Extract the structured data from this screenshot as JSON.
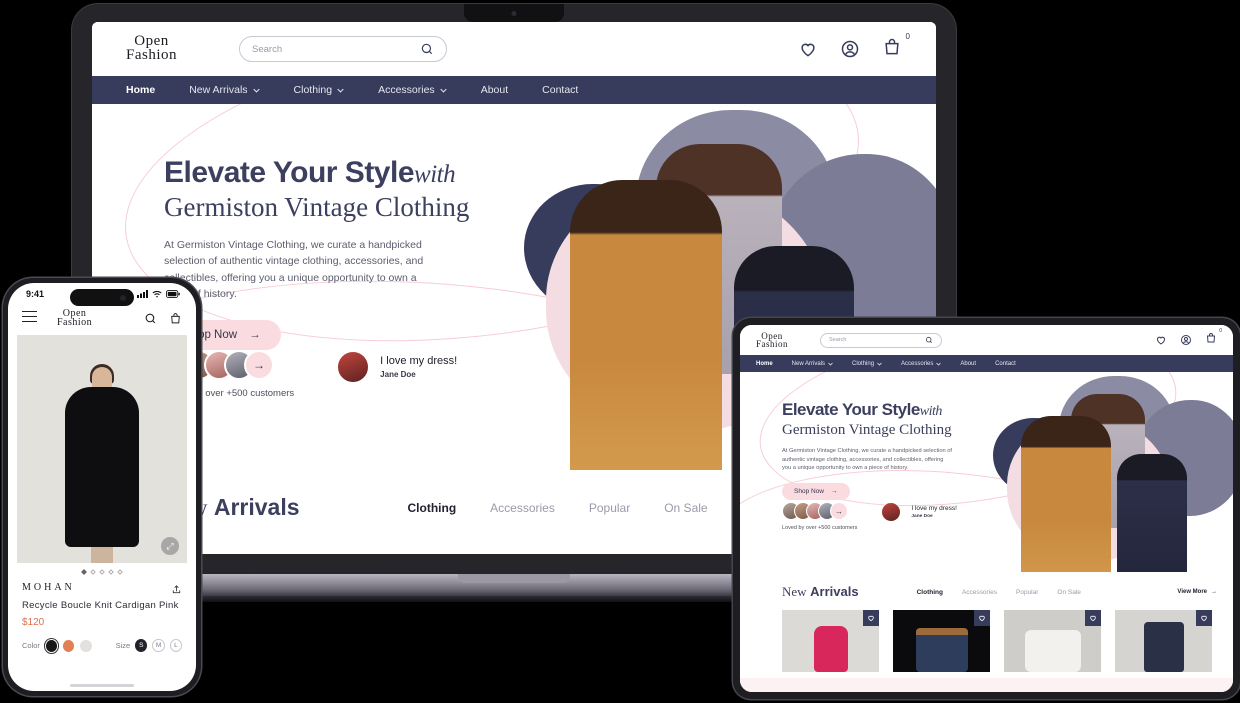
{
  "brand": {
    "line1": "Open",
    "line2": "Fashion"
  },
  "search": {
    "placeholder": "Search",
    "value": ""
  },
  "top_actions": {
    "wishlist_icon": "heart-icon",
    "account_icon": "user-circle-icon",
    "cart_icon": "shopping-bag-icon",
    "cart_count": "0"
  },
  "nav": {
    "items": [
      {
        "label": "Home",
        "has_dropdown": false,
        "active": true
      },
      {
        "label": "New Arrivals",
        "has_dropdown": true,
        "active": false
      },
      {
        "label": "Clothing",
        "has_dropdown": true,
        "active": false
      },
      {
        "label": "Accessories",
        "has_dropdown": true,
        "active": false
      },
      {
        "label": "About",
        "has_dropdown": false,
        "active": false
      },
      {
        "label": "Contact",
        "has_dropdown": false,
        "active": false
      }
    ]
  },
  "hero": {
    "headline_main": "Elevate Your Style",
    "headline_italic": "with",
    "headline_sub": "Germiston Vintage Clothing",
    "body": "At Germiston Vintage Clothing, we curate a handpicked selection of authentic vintage clothing, accessories, and collectibles, offering you a unique opportunity to own a piece of history.",
    "cta_label": "Shop Now",
    "cta_arrow": "arrow-right-icon",
    "social_proof": "Loved by over +500 customers",
    "avatar_arrow_icon": "arrow-right-icon",
    "testimonial_quote": "I love my dress!",
    "testimonial_author": "Jane Doe",
    "colors": {
      "navy": "#373b5c",
      "pink": "#fadce0",
      "gray_blob": "#8b8ba3",
      "pink_blob": "#f3dde2"
    }
  },
  "arrivals": {
    "title_part1": "New",
    "title_part2": "Arrivals",
    "tabs": [
      {
        "label": "Clothing",
        "active": true
      },
      {
        "label": "Accessories",
        "active": false
      },
      {
        "label": "Popular",
        "active": false
      },
      {
        "label": "On Sale",
        "active": false
      }
    ],
    "view_more_label": "View More",
    "view_more_icon": "arrow-right-icon",
    "products": [
      {
        "name": "pink-blazer",
        "color": "#d8275a",
        "heart_icon": "heart-icon"
      },
      {
        "name": "denim-jacket",
        "color": "#2f3d5c",
        "heart_icon": "heart-icon"
      },
      {
        "name": "white-sweatshirt",
        "color": "#f2f1ee",
        "heart_icon": "heart-icon"
      },
      {
        "name": "dark-jeans",
        "color": "#2a3046",
        "heart_icon": "heart-icon"
      }
    ]
  },
  "phone": {
    "status_time": "9:41",
    "signal_icon": "cellular-icon",
    "wifi_icon": "wifi-icon",
    "battery_icon": "battery-icon",
    "menu_icon": "hamburger-menu-icon",
    "search_icon": "search-icon",
    "bag_icon": "shopping-bag-icon",
    "expand_icon": "expand-icon",
    "share_icon": "share-icon",
    "carousel_dots": 5,
    "carousel_active": 1,
    "product": {
      "brand": "MOHAN",
      "name": "Recycle Boucle Knit Cardigan Pink",
      "price": "$120",
      "color_label": "Color",
      "colors": [
        {
          "hex": "#181818",
          "selected": true
        },
        {
          "hex": "#e08155",
          "selected": false
        },
        {
          "hex": "#e3e1dd",
          "selected": false
        }
      ],
      "size_label": "Size",
      "sizes": [
        {
          "label": "S",
          "selected": true
        },
        {
          "label": "M",
          "selected": false
        },
        {
          "label": "L",
          "selected": false
        }
      ]
    }
  }
}
